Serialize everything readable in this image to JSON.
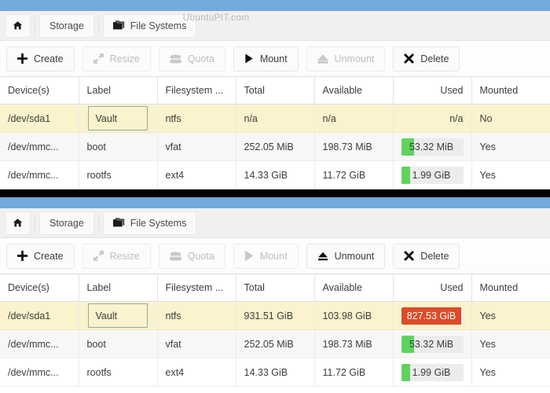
{
  "watermark": "UbuntuPIT.com",
  "theme": {
    "titlebar_blue": "#74a9dc",
    "selected_row": "#faf3cd",
    "usage_green": "#5fd35f",
    "usage_red": "#dd4b28",
    "divider_black": "#000000"
  },
  "breadcrumb": {
    "home_icon": "home-icon",
    "storage_label": "Storage",
    "filesystems_icon": "folder-stack-icon",
    "filesystems_label": "File Systems"
  },
  "table": {
    "columns": [
      {
        "key": "devices",
        "label": "Device(s)",
        "align": "left"
      },
      {
        "key": "label",
        "label": "Label",
        "align": "left"
      },
      {
        "key": "filesystem",
        "label": "Filesystem ...",
        "align": "left"
      },
      {
        "key": "total",
        "label": "Total",
        "align": "left"
      },
      {
        "key": "available",
        "label": "Available",
        "align": "left"
      },
      {
        "key": "used",
        "label": "Used",
        "align": "right"
      },
      {
        "key": "mounted",
        "label": "Mounted",
        "align": "left"
      }
    ]
  },
  "panels": [
    {
      "id": "panel-top",
      "toolbar": [
        {
          "name": "create",
          "label": "Create",
          "icon": "plus-icon",
          "enabled": true
        },
        {
          "name": "resize",
          "label": "Resize",
          "icon": "resize-icon",
          "enabled": false
        },
        {
          "name": "quota",
          "label": "Quota",
          "icon": "users-icon",
          "enabled": false
        },
        {
          "name": "mount",
          "label": "Mount",
          "icon": "play-icon",
          "enabled": true
        },
        {
          "name": "unmount",
          "label": "Unmount",
          "icon": "eject-icon",
          "enabled": false
        },
        {
          "name": "delete",
          "label": "Delete",
          "icon": "x-icon",
          "enabled": true
        }
      ],
      "rows": [
        {
          "devices": "/dev/sda1",
          "label": "Vault",
          "filesystem": "ntfs",
          "total": "n/a",
          "available": "n/a",
          "used": {
            "text": "n/a",
            "percent": 0,
            "color": "none"
          },
          "mounted": "No",
          "selected": true,
          "label_focused": true
        },
        {
          "devices": "/dev/mmc...",
          "label": "boot",
          "filesystem": "vfat",
          "total": "252.05 MiB",
          "available": "198.73 MiB",
          "used": {
            "text": "53.32 MiB",
            "percent": 21,
            "color": "green"
          },
          "mounted": "Yes",
          "selected": false,
          "label_focused": false
        },
        {
          "devices": "/dev/mmc...",
          "label": "rootfs",
          "filesystem": "ext4",
          "total": "14.33 GiB",
          "available": "11.72 GiB",
          "used": {
            "text": "1.99 GiB",
            "percent": 14,
            "color": "green"
          },
          "mounted": "Yes",
          "selected": false,
          "label_focused": false
        }
      ]
    },
    {
      "id": "panel-bottom",
      "toolbar": [
        {
          "name": "create",
          "label": "Create",
          "icon": "plus-icon",
          "enabled": true
        },
        {
          "name": "resize",
          "label": "Resize",
          "icon": "resize-icon",
          "enabled": false
        },
        {
          "name": "quota",
          "label": "Quota",
          "icon": "users-icon",
          "enabled": false
        },
        {
          "name": "mount",
          "label": "Mount",
          "icon": "play-icon",
          "enabled": false
        },
        {
          "name": "unmount",
          "label": "Unmount",
          "icon": "eject-icon",
          "enabled": true
        },
        {
          "name": "delete",
          "label": "Delete",
          "icon": "x-icon",
          "enabled": true
        }
      ],
      "rows": [
        {
          "devices": "/dev/sda1",
          "label": "Vault",
          "filesystem": "ntfs",
          "total": "931.51 GiB",
          "available": "103.98 GiB",
          "used": {
            "text": "827.53 GiB",
            "percent": 97,
            "color": "red"
          },
          "mounted": "Yes",
          "selected": true,
          "label_focused": true
        },
        {
          "devices": "/dev/mmc...",
          "label": "boot",
          "filesystem": "vfat",
          "total": "252.05 MiB",
          "available": "198.73 MiB",
          "used": {
            "text": "53.32 MiB",
            "percent": 21,
            "color": "green"
          },
          "mounted": "Yes",
          "selected": false,
          "label_focused": false
        },
        {
          "devices": "/dev/mmc...",
          "label": "rootfs",
          "filesystem": "ext4",
          "total": "14.33 GiB",
          "available": "11.72 GiB",
          "used": {
            "text": "1.99 GiB",
            "percent": 14,
            "color": "green"
          },
          "mounted": "Yes",
          "selected": false,
          "label_focused": false
        }
      ]
    }
  ]
}
